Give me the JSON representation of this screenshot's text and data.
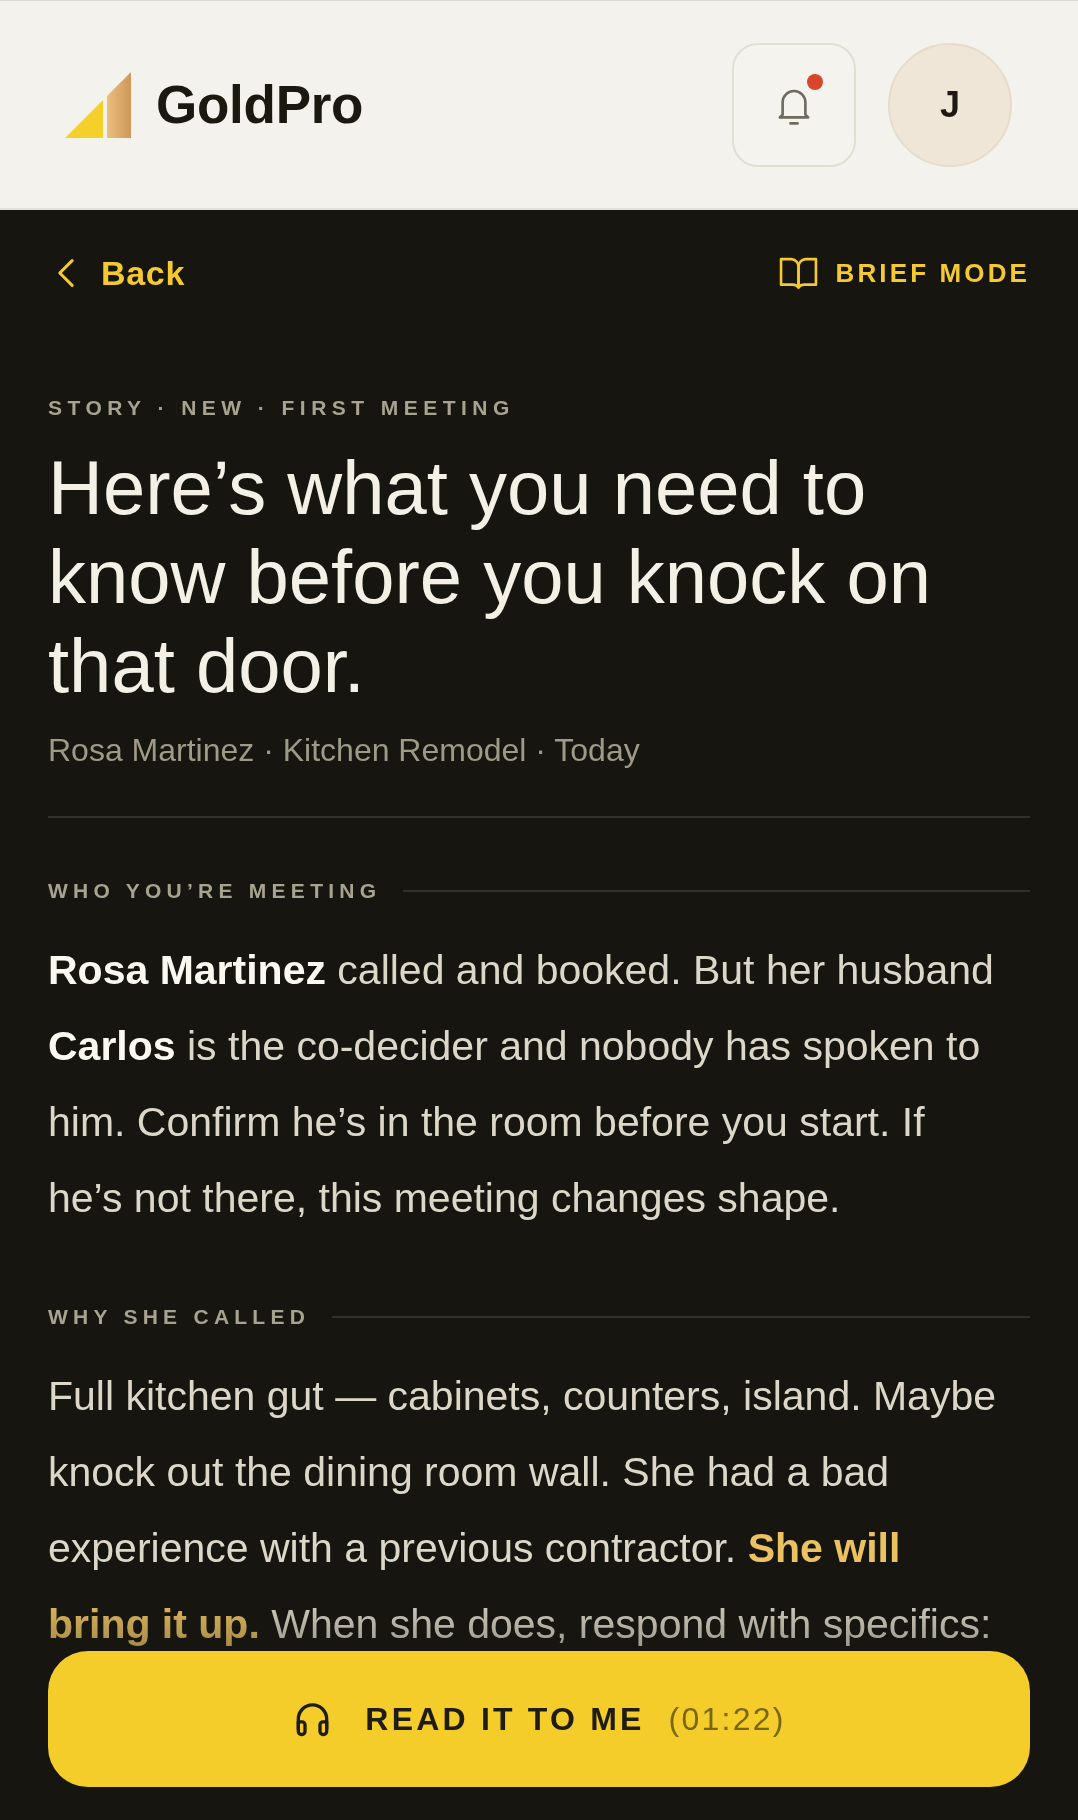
{
  "header": {
    "brand": "GoldPro",
    "notifications": {
      "unread": true
    },
    "avatar_initial": "J"
  },
  "nav": {
    "back_label": "Back",
    "mode_label": "BRIEF MODE"
  },
  "story": {
    "tags": "STORY · NEW · FIRST MEETING",
    "headline": "Here’s what you need to know before you knock on that door.",
    "meta": "Rosa Martinez · Kitchen Remodel · Today"
  },
  "sections": [
    {
      "label": "WHO YOU’RE MEETING",
      "kind": "plain",
      "body": "**Rosa Martinez** called and booked. But her husband **Carlos** is the co-decider and nobody has spoken to him. Confirm he’s in the room before you start. If he’s not there, this meeting changes shape."
    },
    {
      "label": "WHY SHE CALLED",
      "kind": "highlight",
      "body": "Full kitchen gut — cabinets, counters, island. Maybe knock out the dining room wall. She had a bad experience with a previous contractor. **She will bring it up.** When she does, respond with specifics:"
    }
  ],
  "read_aloud": {
    "label": "READ IT TO ME",
    "duration": "(01:22)"
  }
}
